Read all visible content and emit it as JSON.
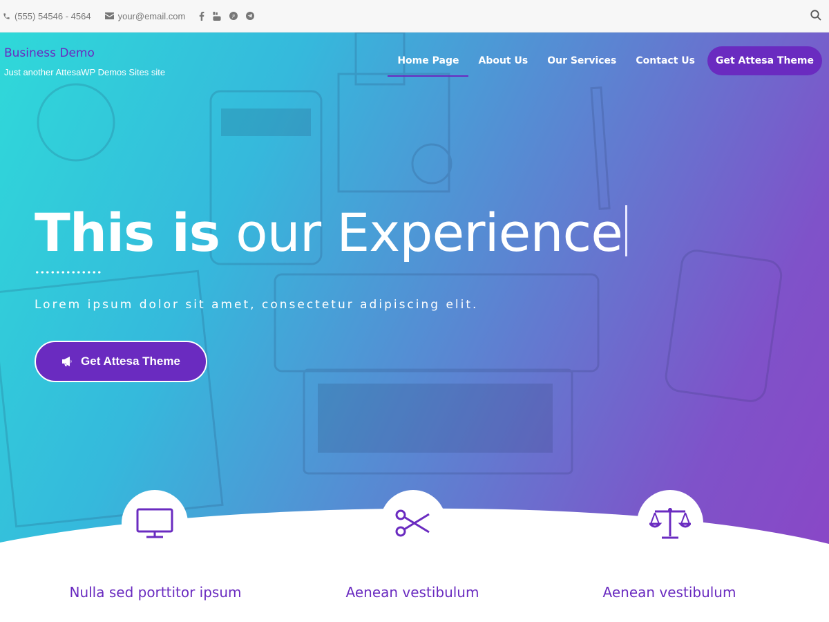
{
  "topbar": {
    "phone": "(555) 54546 - 4564",
    "email": "your@email.com",
    "social_icons": [
      "facebook-icon",
      "youtube-icon",
      "pinterest-icon",
      "telegram-icon"
    ],
    "search_icon": "search-icon"
  },
  "brand": {
    "title": "Business Demo",
    "tagline": "Just another AttesaWP Demos Sites site"
  },
  "nav": {
    "items": [
      {
        "label": "Home Page",
        "active": true
      },
      {
        "label": "About Us",
        "active": false
      },
      {
        "label": "Our Services",
        "active": false
      },
      {
        "label": "Contact Us",
        "active": false
      }
    ],
    "cta_label": "Get Attesa Theme"
  },
  "hero": {
    "headline_bold": "This is",
    "headline_light": "our Experience",
    "subtitle": "Lorem ipsum dolor sit amet, consectetur adipiscing elit.",
    "cta_label": "Get Attesa Theme",
    "cta_icon": "megaphone-icon"
  },
  "features": [
    {
      "icon": "monitor-icon",
      "title": "Nulla sed porttitor ipsum"
    },
    {
      "icon": "scissors-icon",
      "title": "Aenean vestibulum"
    },
    {
      "icon": "scales-icon",
      "title": "Aenean vestibulum"
    }
  ],
  "colors": {
    "accent": "#6a2bc0",
    "gradient_start": "#2fd9d9",
    "gradient_end": "#8b45c6",
    "topbar_bg": "#f7f7f7"
  }
}
